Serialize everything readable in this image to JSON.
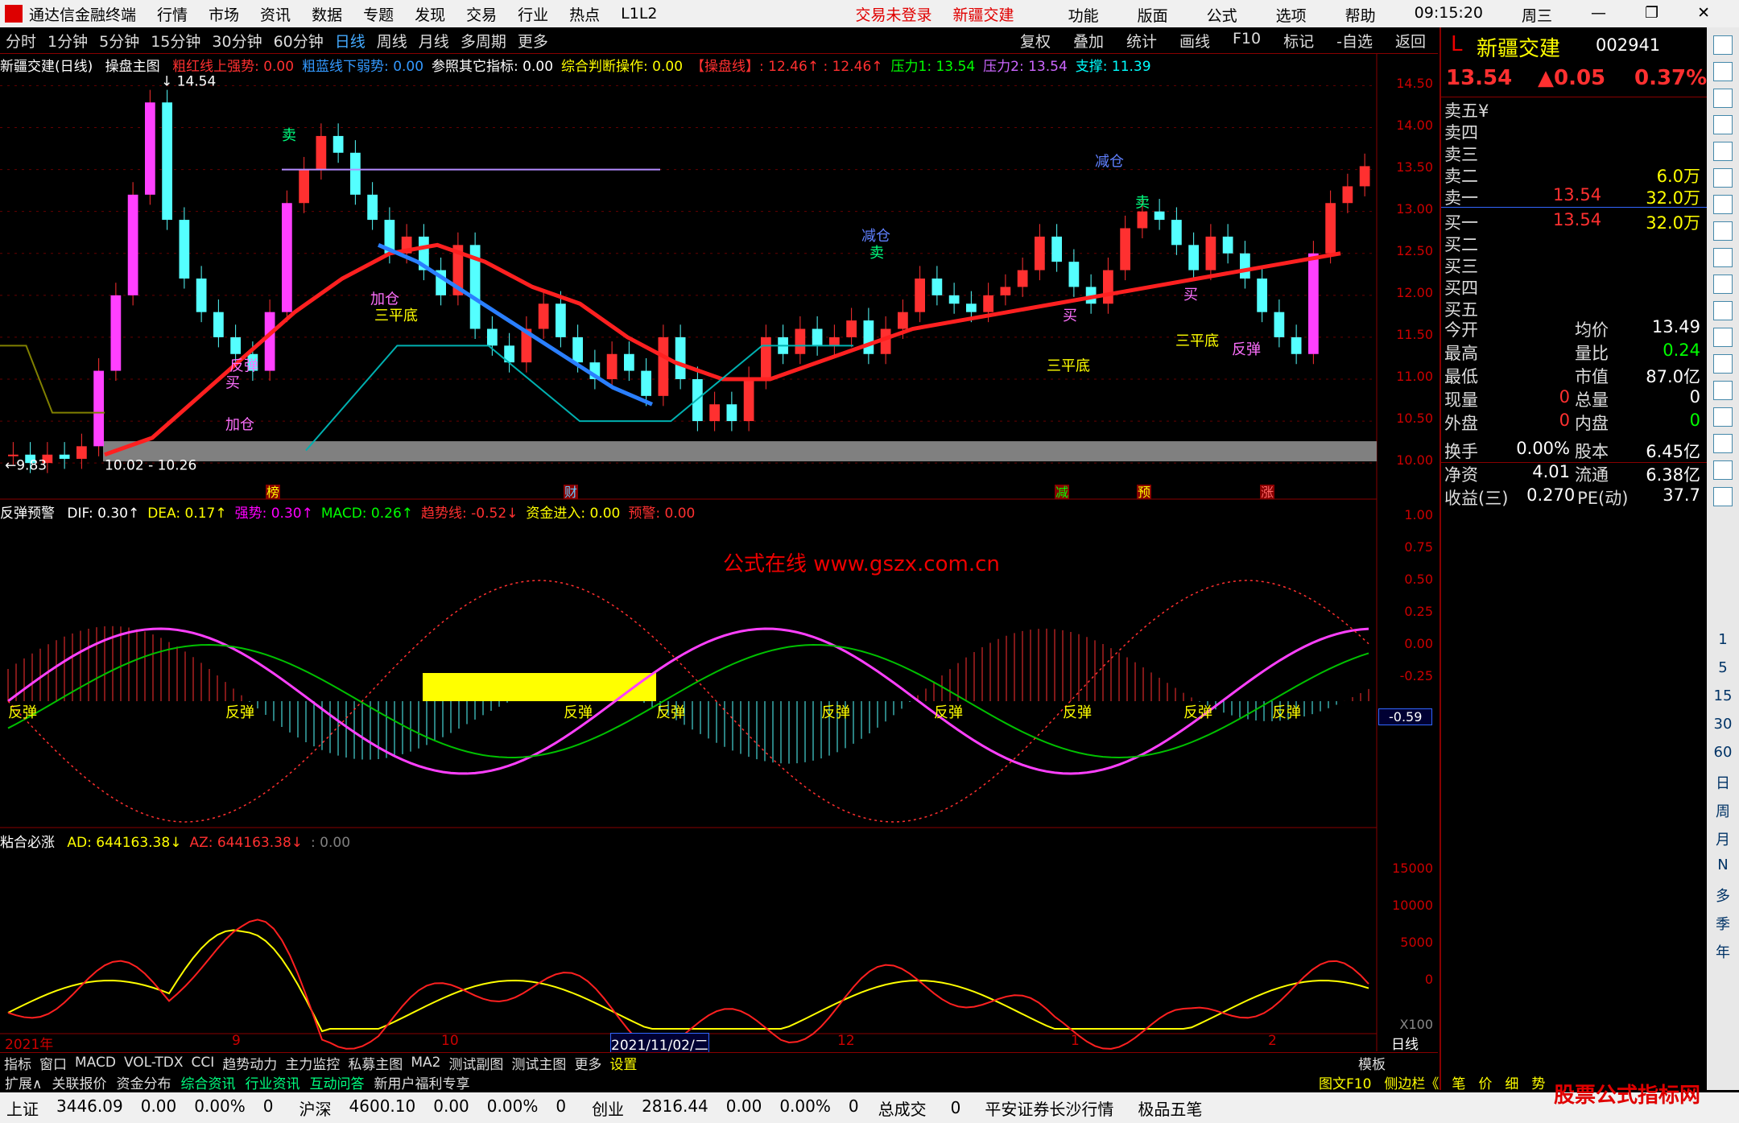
{
  "menu": {
    "app": "通达信金融终端",
    "items": [
      "行情",
      "市场",
      "资讯",
      "数据",
      "专题",
      "发现",
      "交易",
      "行业",
      "热点",
      "L1L2"
    ],
    "login": "交易未登录",
    "stock": "新疆交建",
    "right": [
      "功能",
      "版面",
      "公式",
      "选项",
      "帮助"
    ],
    "time": "09:15:20",
    "weekday": "周三"
  },
  "toolbar": {
    "periods": [
      "分时",
      "1分钟",
      "5分钟",
      "15分钟",
      "30分钟",
      "60分钟",
      "日线",
      "周线",
      "月线",
      "多周期",
      "更多"
    ],
    "right": [
      "复权",
      "叠加",
      "统计",
      "画线",
      "F10",
      "标记",
      "-自选",
      "返回"
    ]
  },
  "main": {
    "title": "新疆交建(日线)",
    "formula": "操盘主图",
    "items": [
      {
        "t": "粗红线上强势: 0.00",
        "c": "#ff3030"
      },
      {
        "t": "粗蓝线下弱势: 0.00",
        "c": "#3399ff"
      },
      {
        "t": "参照其它指标: 0.00",
        "c": "#ffffff"
      },
      {
        "t": "综合判断操作: 0.00",
        "c": "#ffff00"
      },
      {
        "t": "【操盘线】: 12.46↑ : 12.46↑",
        "c": "#ff3030"
      },
      {
        "t": "压力1: 13.54",
        "c": "#00ff00"
      },
      {
        "t": "压力2: 13.54",
        "c": "#cc66ff"
      },
      {
        "t": "支撑: 11.39",
        "c": "#00ffff"
      }
    ],
    "hi_label": "14.54",
    "lo_label": "9.83",
    "range_label": "10.02 - 10.26",
    "annots": [
      "卖",
      "加仓",
      "三平底",
      "反弹",
      "买",
      "加仓",
      "减仓",
      "卖",
      "减仓",
      "卖",
      "买",
      "三平底",
      "买",
      "三平底",
      "反弹"
    ],
    "events": [
      "榜",
      "财",
      "减",
      "预",
      "涨"
    ]
  },
  "sub1": {
    "title": "反弹预警",
    "items": [
      {
        "t": "DIF: 0.30↑",
        "c": "#ffffff"
      },
      {
        "t": "DEA: 0.17↑",
        "c": "#ffff00"
      },
      {
        "t": "强势: 0.30↑",
        "c": "#ff00ff"
      },
      {
        "t": "MACD: 0.26↑",
        "c": "#00ff00"
      },
      {
        "t": "趋势线: -0.52↓",
        "c": "#ff3030"
      },
      {
        "t": "资金进入: 0.00",
        "c": "#ffff00"
      },
      {
        "t": "预警: 0.00",
        "c": "#ff3030"
      }
    ],
    "watermark": "公式在线  www.gszx.com.cn",
    "cur": "-0.59",
    "ticks": [
      "1.00",
      "0.75",
      "0.50",
      "0.25",
      "0.00",
      "-0.25"
    ],
    "annot": "反弹"
  },
  "sub2": {
    "title": "粘合必涨",
    "items": [
      {
        "t": "AD: 644163.38↓",
        "c": "#ffff00"
      },
      {
        "t": "AZ: 644163.38↓",
        "c": "#ff3030"
      },
      {
        "t": ": 0.00",
        "c": "#808080"
      }
    ],
    "ticks": [
      "15000",
      "10000",
      "5000",
      "0"
    ],
    "unit": "X100"
  },
  "main_ticks": [
    "14.50",
    "14.00",
    "13.50",
    "13.00",
    "12.50",
    "12.00",
    "11.50",
    "11.00",
    "10.50",
    "10.00"
  ],
  "dates": {
    "year": "2021年",
    "m9": "9",
    "m10": "10",
    "cursor": "2021/11/02/二",
    "m12": "12",
    "m1": "1",
    "m2": "2",
    "period": "日线"
  },
  "bottom": [
    "指标",
    "窗口",
    "MACD",
    "VOL-TDX",
    "CCI",
    "趋势动力",
    "主力监控",
    "私募主图",
    "MA2",
    "测试副图",
    "测试主图",
    "更多",
    "设置"
  ],
  "bottom_right": "模板",
  "bottom2": [
    "扩展∧",
    "关联报价",
    "资金分布",
    "综合资讯",
    "行业资讯",
    "互动问答",
    "新用户福利专享"
  ],
  "bottom2_right": [
    "图文F10",
    "侧边栏《",
    "笔",
    "价",
    "细",
    "势"
  ],
  "status": [
    {
      "n": "上证",
      "v": "3446.09",
      "c": "0.00",
      "p": "0.00%",
      "x": "0"
    },
    {
      "n": "沪深",
      "v": "4600.10",
      "c": "0.00",
      "p": "0.00%",
      "x": "0"
    },
    {
      "n": "创业",
      "v": "2816.44",
      "c": "0.00",
      "p": "0.00%",
      "x": "0"
    }
  ],
  "status_extra": [
    "总成交",
    "0",
    "平安证券长沙行情",
    "极品五笔"
  ],
  "quote": {
    "flag": "L",
    "name": "新疆交建",
    "code": "002941",
    "price": "13.54",
    "chg": "▲0.05",
    "pct": "0.37%",
    "asks": [
      [
        "卖五",
        "¥",
        ""
      ],
      [
        "卖四",
        "",
        ""
      ],
      [
        "卖三",
        "",
        ""
      ],
      [
        "卖二",
        "",
        "6.0万"
      ],
      [
        "卖一",
        "13.54",
        "32.0万"
      ]
    ],
    "bids": [
      [
        "买一",
        "13.54",
        "32.0万"
      ],
      [
        "买二",
        "",
        ""
      ],
      [
        "买三",
        "",
        ""
      ],
      [
        "买四",
        "",
        ""
      ],
      [
        "买五",
        "",
        ""
      ]
    ],
    "stats": [
      [
        "今开",
        "",
        "均价",
        "13.49"
      ],
      [
        "最高",
        "",
        "量比",
        "0.24"
      ],
      [
        "最低",
        "",
        "市值",
        "87.0亿"
      ],
      [
        "现量",
        "0",
        "总量",
        "0"
      ],
      [
        "外盘",
        "0",
        "内盘",
        "0"
      ],
      [
        "换手",
        "0.00%",
        "股本",
        "6.45亿"
      ],
      [
        "净资",
        "4.01",
        "流通",
        "6.38亿"
      ],
      [
        "收益(三)",
        "0.270",
        "PE(动)",
        "37.7"
      ]
    ]
  },
  "side_labels": [
    "1",
    "5",
    "15",
    "30",
    "60",
    "日",
    "周",
    "月",
    "N",
    "多",
    "季",
    "年"
  ],
  "watermark_site": "股票公式指标网",
  "chart_data": {
    "type": "candlestick",
    "title": "新疆交建(日线)",
    "ylim": [
      9.8,
      14.6
    ],
    "close_series": [
      10.1,
      10.0,
      10.1,
      10.05,
      10.2,
      11.1,
      12.0,
      13.2,
      14.3,
      12.9,
      12.2,
      11.8,
      11.5,
      11.3,
      11.1,
      11.8,
      13.1,
      13.5,
      13.9,
      13.7,
      13.2,
      12.9,
      12.5,
      12.7,
      12.3,
      12.0,
      12.6,
      11.6,
      11.4,
      11.2,
      11.6,
      11.9,
      11.5,
      11.2,
      11.0,
      11.3,
      11.1,
      10.8,
      11.5,
      11.0,
      10.5,
      10.7,
      10.5,
      11.0,
      11.5,
      11.3,
      11.6,
      11.4,
      11.5,
      11.7,
      11.3,
      11.6,
      11.8,
      12.2,
      12.0,
      11.9,
      11.8,
      12.0,
      12.1,
      12.3,
      12.7,
      12.4,
      12.1,
      11.9,
      12.3,
      12.8,
      13.0,
      12.9,
      12.6,
      12.3,
      12.7,
      12.5,
      12.2,
      11.8,
      11.5,
      11.3,
      12.5,
      13.1,
      13.3,
      13.54
    ],
    "ma_red": [
      10.1,
      10.3,
      10.8,
      11.3,
      11.8,
      12.2,
      12.5,
      12.6,
      12.4,
      12.1,
      11.9,
      11.5,
      11.2,
      11.0,
      11.0,
      11.2,
      11.4,
      11.6,
      11.7,
      11.8,
      11.9,
      12.0,
      12.1,
      12.2,
      12.3,
      12.4,
      12.5
    ],
    "ma_blue": [
      12.6,
      12.4,
      12.1,
      11.8,
      11.5,
      11.2,
      10.9,
      10.7
    ]
  }
}
